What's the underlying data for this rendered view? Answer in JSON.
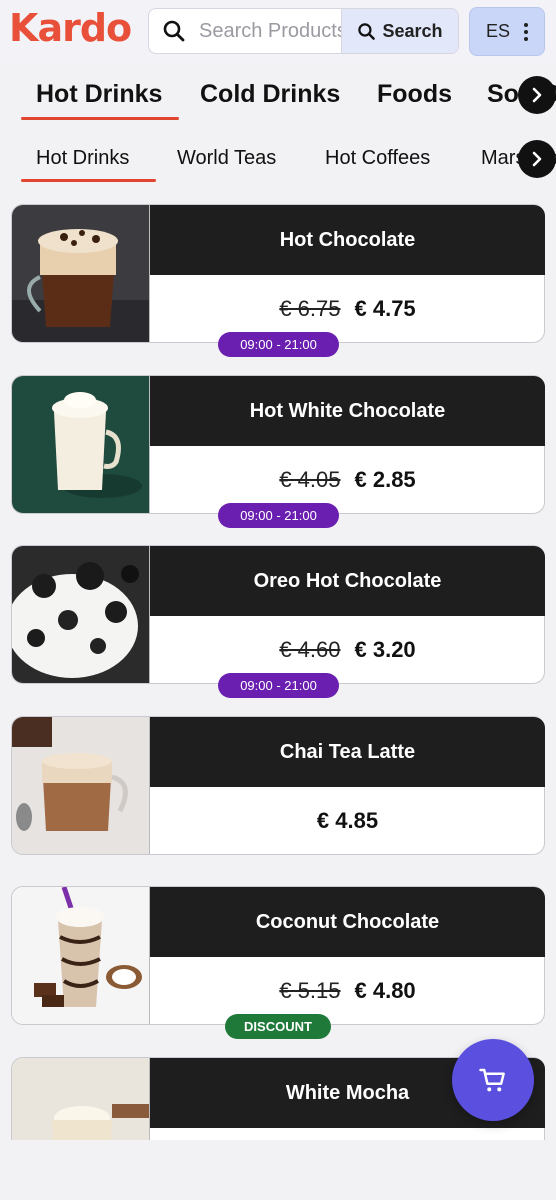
{
  "header": {
    "logo": "Kardo",
    "search_placeholder": "Search Products",
    "search_button": "Search",
    "language": "ES"
  },
  "main_tabs": [
    {
      "label": "Hot Drinks",
      "active": true
    },
    {
      "label": "Cold Drinks",
      "active": false
    },
    {
      "label": "Foods",
      "active": false
    },
    {
      "label": "Soft Drinks",
      "active": false
    }
  ],
  "sub_tabs": [
    {
      "label": "Hot Drinks",
      "active": true
    },
    {
      "label": "World Teas",
      "active": false
    },
    {
      "label": "Hot Coffees",
      "active": false
    },
    {
      "label": "Marshmallow",
      "active": false
    }
  ],
  "products": [
    {
      "name": "Hot Chocolate",
      "old_price": "€ 6.75",
      "price": "€ 4.75",
      "badge": "09:00 - 21:00",
      "badge_type": "time",
      "image": "hot-chocolate"
    },
    {
      "name": "Hot White Chocolate",
      "old_price": "€ 4.05",
      "price": "€ 2.85",
      "badge": "09:00 - 21:00",
      "badge_type": "time",
      "image": "white-chocolate"
    },
    {
      "name": "Oreo Hot Chocolate",
      "old_price": "€ 4.60",
      "price": "€ 3.20",
      "badge": "09:00 - 21:00",
      "badge_type": "time",
      "image": "oreo-chocolate"
    },
    {
      "name": "Chai Tea Latte",
      "old_price": "",
      "price": "€ 4.85",
      "badge": "",
      "badge_type": "",
      "image": "chai-latte"
    },
    {
      "name": "Coconut Chocolate",
      "old_price": "€ 5.15",
      "price": "€ 4.80",
      "badge": "DISCOUNT",
      "badge_type": "discount",
      "image": "coconut-chocolate"
    },
    {
      "name": "White Mocha",
      "old_price": "",
      "price": "",
      "badge": "",
      "badge_type": "",
      "image": "white-mocha"
    }
  ],
  "colors": {
    "brand": "#e8503a",
    "time_badge": "#6a1fb0",
    "discount_badge": "#1f7a3a",
    "cart_button": "#5b4fe0"
  },
  "icons": {
    "search": "search-icon",
    "menu": "more-vertical-icon",
    "arrow": "chevron-right-icon",
    "cart": "shopping-cart-icon"
  }
}
